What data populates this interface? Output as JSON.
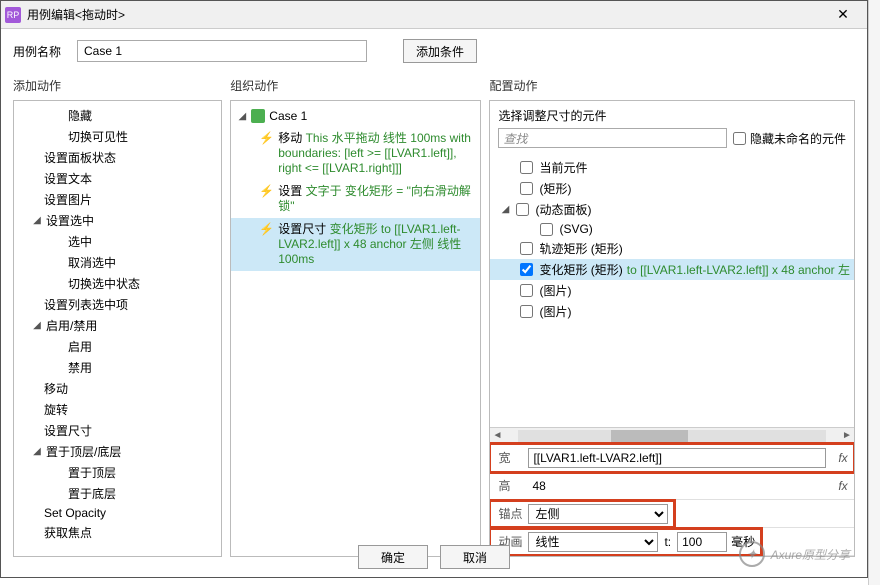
{
  "dialog": {
    "title": "用例编辑<拖动时>",
    "case_label": "用例名称",
    "case_name": "Case 1",
    "add_condition": "添加条件"
  },
  "columns": {
    "add_action": "添加动作",
    "organize_action": "组织动作",
    "configure_action": "配置动作"
  },
  "action_tree": [
    "隐藏",
    "切换可见性",
    "设置面板状态",
    "设置文本",
    "设置图片",
    "设置选中",
    "选中",
    "取消选中",
    "切换选中状态",
    "设置列表选中项",
    "启用/禁用",
    "启用",
    "禁用",
    "移动",
    "旋转",
    "设置尺寸",
    "置于顶层/底层",
    "置于顶层",
    "置于底层",
    "Set Opacity",
    "获取焦点"
  ],
  "branch_indices": [
    5,
    10,
    16
  ],
  "child_indices": [
    0,
    1,
    6,
    7,
    8,
    11,
    12,
    17,
    18
  ],
  "organize": {
    "case": "Case 1",
    "actions": [
      {
        "name": "移动",
        "value": "This 水平拖动 线性 100ms with boundaries: [left >= [[LVAR1.left]], right <= [[LVAR1.right]]]"
      },
      {
        "name": "设置",
        "value": "文字于 变化矩形 = \"向右滑动解锁\""
      },
      {
        "name": "设置尺寸",
        "value": "变化矩形 to [[LVAR1.left-LVAR2.left]] x 48 anchor 左侧 线性 100ms",
        "selected": true
      }
    ]
  },
  "configure": {
    "header": "选择调整尺寸的元件",
    "search_placeholder": "查找",
    "hide_unnamed": "隐藏未命名的元件",
    "elements": [
      {
        "label": "当前元件",
        "indent": 0
      },
      {
        "label": "(矩形)",
        "indent": 0
      },
      {
        "label": "(动态面板)",
        "indent": 0,
        "expandable": true
      },
      {
        "label": "(SVG)",
        "indent": 1
      },
      {
        "label": "轨迹矩形 (矩形)",
        "indent": 0
      },
      {
        "label": "变化矩形 (矩形)",
        "green": " to [[LVAR1.left-LVAR2.left]] x 48 anchor 左",
        "indent": 0,
        "checked": true,
        "selected": true
      },
      {
        "label": "(图片)",
        "indent": 0
      },
      {
        "label": "(图片)",
        "indent": 0
      }
    ],
    "width_label": "宽",
    "width_value": "[[LVAR1.left-LVAR2.left]]",
    "height_label": "高",
    "height_value": "48",
    "anchor_label": "锚点",
    "anchor_value": "左侧",
    "anim_label": "动画",
    "anim_value": "线性",
    "time_label": "t:",
    "time_value": "100",
    "time_unit": "毫秒",
    "fx": "fx"
  },
  "footer": {
    "ok": "确定",
    "cancel": "取消"
  },
  "watermark": "Axure原型分享"
}
